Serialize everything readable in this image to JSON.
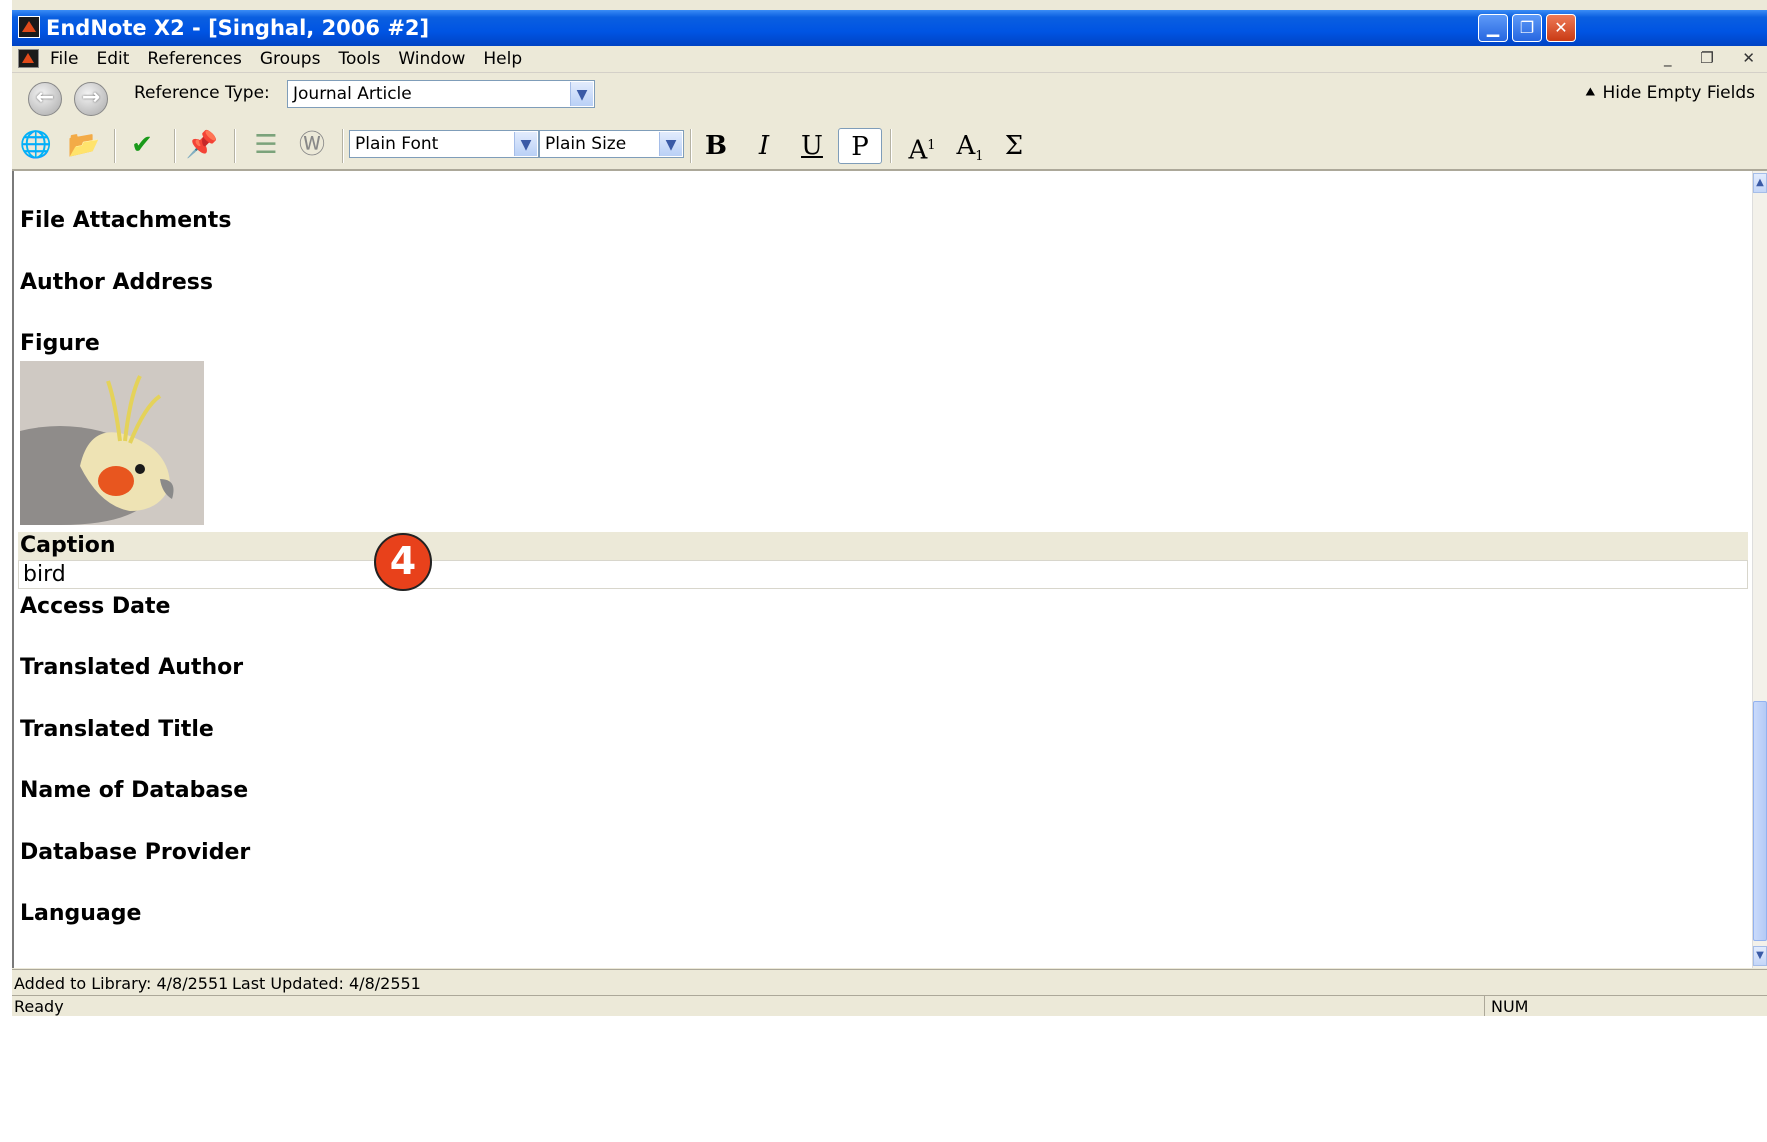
{
  "window": {
    "title": "EndNote X2 - [Singhal, 2006 #2]",
    "minimize_glyph": "▁",
    "restore_glyph": "❐",
    "close_glyph": "✕"
  },
  "menu": {
    "items": [
      "File",
      "Edit",
      "References",
      "Groups",
      "Tools",
      "Window",
      "Help"
    ],
    "mdi_controls": "_ ❐ ✕"
  },
  "reference": {
    "back_glyph": "←",
    "forward_glyph": "→",
    "type_label": "Reference Type:",
    "type_value": "Journal Article",
    "hide_empty": "⯅ Hide Empty Fields"
  },
  "toolbar": {
    "icons": [
      "insert-citation-icon",
      "open-folder-icon",
      "check-spelling-icon",
      "pin-icon",
      "list-icon",
      "word-icon"
    ],
    "font_value": "Plain Font",
    "size_value": "Plain Size",
    "bold": "B",
    "italic": "I",
    "underline": "U",
    "plain": "P",
    "superscript": "A",
    "superscript_mark": "1",
    "subscript": "A",
    "subscript_mark": "1",
    "symbol": "Σ"
  },
  "fields": {
    "file_attachments": "File Attachments",
    "author_address": "Author Address",
    "figure": "Figure",
    "caption": "Caption",
    "caption_value": "bird",
    "access_date": "Access Date",
    "translated_author": "Translated Author",
    "translated_title": "Translated Title",
    "name_of_database": "Name of Database",
    "database_provider": "Database Provider",
    "language": "Language"
  },
  "annotation": {
    "step_number": "4",
    "color": "#e8411b"
  },
  "footer": {
    "added": "Added to Library: 4/8/2551",
    "updated": "Last Updated: 4/8/2551",
    "status": "Ready",
    "num": "NUM"
  }
}
